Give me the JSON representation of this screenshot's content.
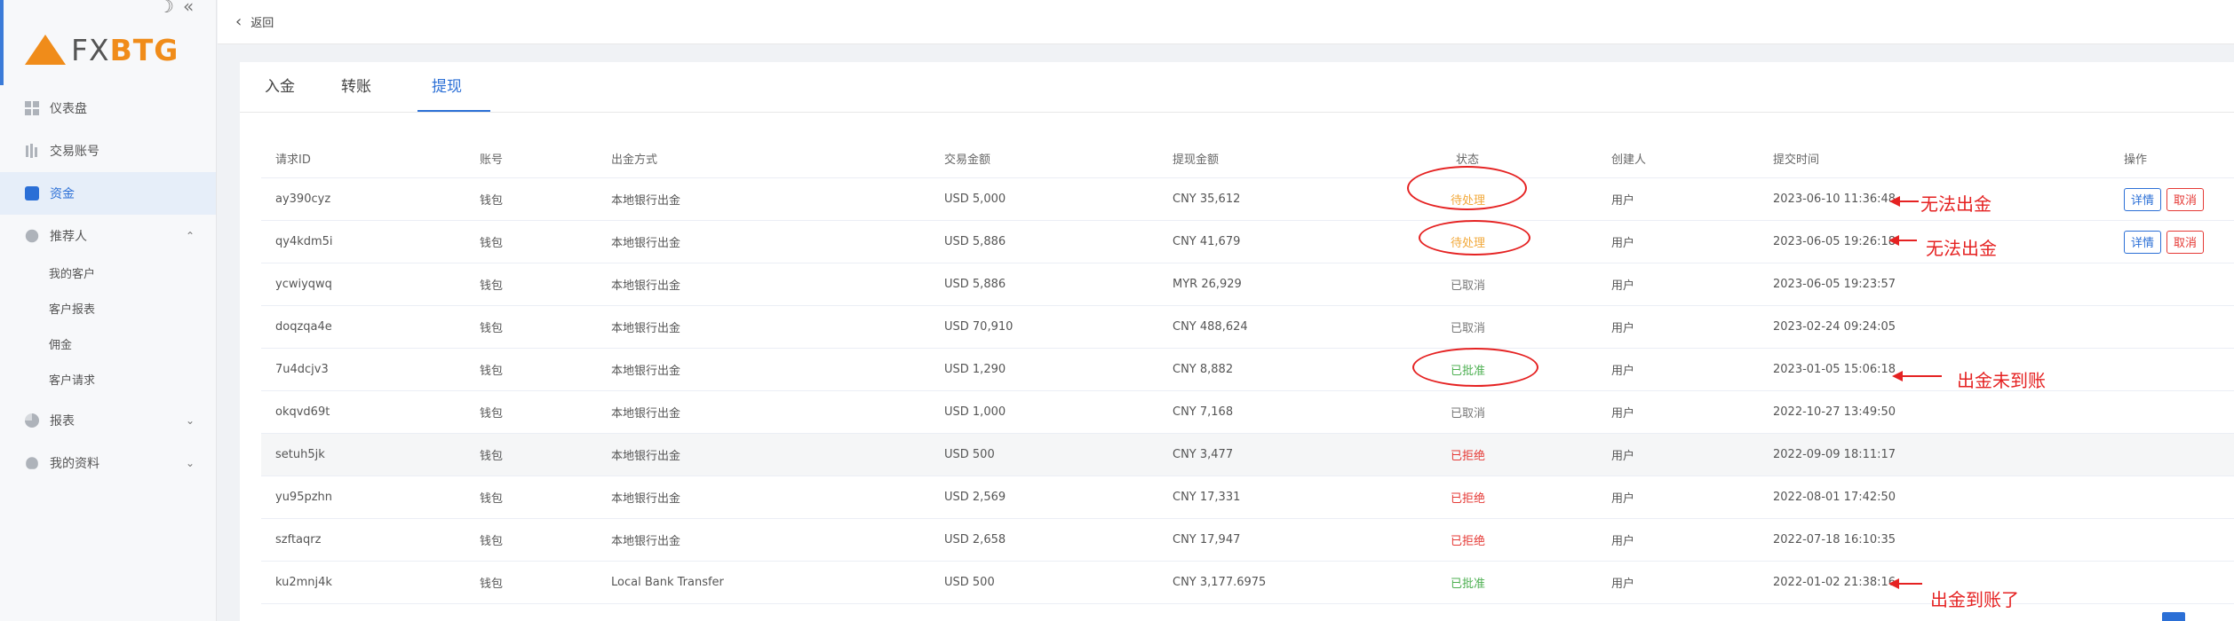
{
  "logo": {
    "fx": "FX",
    "btg": "BTG"
  },
  "sidebar": {
    "items": [
      {
        "label": "仪表盘",
        "icon": "dashboard-icon"
      },
      {
        "label": "交易账号",
        "icon": "trading-account-icon"
      },
      {
        "label": "资金",
        "icon": "wallet-icon"
      },
      {
        "label": "推荐人",
        "icon": "referrer-icon"
      },
      {
        "label": "报表",
        "icon": "report-icon"
      },
      {
        "label": "我的资料",
        "icon": "profile-icon"
      }
    ],
    "sub_items": [
      {
        "label": "我的客户"
      },
      {
        "label": "客户报表"
      },
      {
        "label": "佣金"
      },
      {
        "label": "客户请求"
      }
    ]
  },
  "header": {
    "back_label": "返回"
  },
  "tabs": [
    {
      "label": "入金"
    },
    {
      "label": "转账"
    },
    {
      "label": "提现"
    }
  ],
  "table": {
    "headers": [
      "请求ID",
      "账号",
      "出金方式",
      "交易金额",
      "提现金额",
      "状态",
      "创建人",
      "提交时间",
      "操作"
    ],
    "rows": [
      {
        "id": "ay390cyz",
        "account": "钱包",
        "method": "本地银行出金",
        "amount": "USD 5,000",
        "withdraw": "CNY 35,612",
        "status": "待处理",
        "creator": "用户",
        "time": "2023-06-10 11:36:48"
      },
      {
        "id": "qy4kdm5i",
        "account": "钱包",
        "method": "本地银行出金",
        "amount": "USD 5,886",
        "withdraw": "CNY 41,679",
        "status": "待处理",
        "creator": "用户",
        "time": "2023-06-05 19:26:18"
      },
      {
        "id": "ycwiyqwq",
        "account": "钱包",
        "method": "本地银行出金",
        "amount": "USD 5,886",
        "withdraw": "MYR 26,929",
        "status": "已取消",
        "creator": "用户",
        "time": "2023-06-05 19:23:57"
      },
      {
        "id": "doqzqa4e",
        "account": "钱包",
        "method": "本地银行出金",
        "amount": "USD 70,910",
        "withdraw": "CNY 488,624",
        "status": "已取消",
        "creator": "用户",
        "time": "2023-02-24 09:24:05"
      },
      {
        "id": "7u4dcjv3",
        "account": "钱包",
        "method": "本地银行出金",
        "amount": "USD 1,290",
        "withdraw": "CNY 8,882",
        "status": "已批准",
        "creator": "用户",
        "time": "2023-01-05 15:06:18"
      },
      {
        "id": "okqvd69t",
        "account": "钱包",
        "method": "本地银行出金",
        "amount": "USD 1,000",
        "withdraw": "CNY 7,168",
        "status": "已取消",
        "creator": "用户",
        "time": "2022-10-27 13:49:50"
      },
      {
        "id": "setuh5jk",
        "account": "钱包",
        "method": "本地银行出金",
        "amount": "USD 500",
        "withdraw": "CNY 3,477",
        "status": "已拒绝",
        "creator": "用户",
        "time": "2022-09-09 18:11:17"
      },
      {
        "id": "yu95pzhn",
        "account": "钱包",
        "method": "本地银行出金",
        "amount": "USD 2,569",
        "withdraw": "CNY 17,331",
        "status": "已拒绝",
        "creator": "用户",
        "time": "2022-08-01 17:42:50"
      },
      {
        "id": "szftaqrz",
        "account": "钱包",
        "method": "本地银行出金",
        "amount": "USD 2,658",
        "withdraw": "CNY 17,947",
        "status": "已拒绝",
        "creator": "用户",
        "time": "2022-07-18 16:10:35"
      },
      {
        "id": "ku2mnj4k",
        "account": "钱包",
        "method": "Local Bank Transfer",
        "amount": "USD 500",
        "withdraw": "CNY 3,177.6975",
        "status": "已批准",
        "creator": "用户",
        "time": "2022-01-02 21:38:16"
      }
    ],
    "actions": {
      "detail": "详情",
      "cancel": "取消"
    }
  },
  "annotations": {
    "note1": "无法出金",
    "note2": "无法出金",
    "note3": "出金未到账",
    "note4": "出金到账了",
    "color": "#e52222"
  },
  "colors": {
    "accent": "#2b6fd6",
    "brand_orange": "#f08c1a",
    "pending": "#f2a93b",
    "approved": "#4caf50",
    "rejected": "#e53935"
  }
}
